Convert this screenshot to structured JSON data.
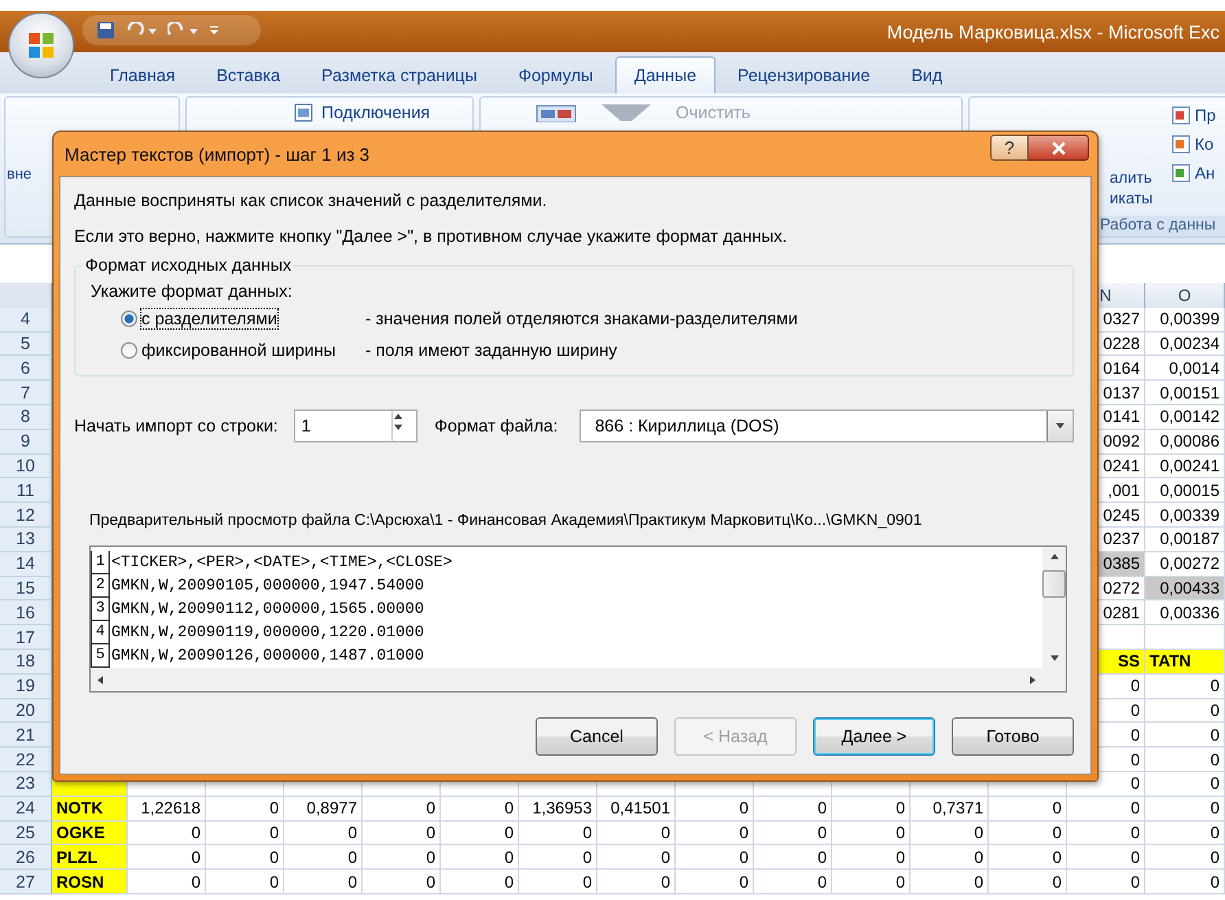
{
  "title_bar": {
    "title": "Модель Марковица.xlsx - Microsoft Exc"
  },
  "ribbon": {
    "tabs": [
      {
        "label": "Главная",
        "selected": false
      },
      {
        "label": "Вставка",
        "selected": false
      },
      {
        "label": "Разметка страницы",
        "selected": false
      },
      {
        "label": "Формулы",
        "selected": false
      },
      {
        "label": "Данные",
        "selected": true
      },
      {
        "label": "Рецензирование",
        "selected": false
      },
      {
        "label": "Вид",
        "selected": false
      }
    ],
    "left_fragment": "вне",
    "connections": "Подключения",
    "clear": {
      "label": "Очистить",
      "disabled": true
    },
    "duplicates_fragments": [
      "алить",
      "икаты"
    ],
    "side_commands": [
      "Пр",
      "Ко",
      "Ан"
    ],
    "group_label": "Работа с данны"
  },
  "sheet": {
    "column_headers": [
      "N",
      "O"
    ],
    "upper_rows": [
      {
        "row": "4",
        "kind": "values",
        "cells": [
          {
            "text": "0327",
            "shaded": false
          },
          {
            "text": "0,00399",
            "shaded": false
          }
        ]
      },
      {
        "row": "5",
        "kind": "values",
        "cells": [
          {
            "text": "0228",
            "shaded": false
          },
          {
            "text": "0,00234",
            "shaded": false
          }
        ]
      },
      {
        "row": "6",
        "kind": "values",
        "cells": [
          {
            "text": "0164",
            "shaded": false
          },
          {
            "text": "0,0014",
            "shaded": false
          }
        ]
      },
      {
        "row": "7",
        "kind": "values",
        "cells": [
          {
            "text": "0137",
            "shaded": false
          },
          {
            "text": "0,00151",
            "shaded": false
          }
        ]
      },
      {
        "row": "8",
        "kind": "values",
        "cells": [
          {
            "text": "0141",
            "shaded": false
          },
          {
            "text": "0,00142",
            "shaded": false
          }
        ]
      },
      {
        "row": "9",
        "kind": "values",
        "cells": [
          {
            "text": "0092",
            "shaded": false
          },
          {
            "text": "0,00086",
            "shaded": false
          }
        ]
      },
      {
        "row": "10",
        "kind": "values",
        "cells": [
          {
            "text": "0241",
            "shaded": false
          },
          {
            "text": "0,00241",
            "shaded": false
          }
        ]
      },
      {
        "row": "11",
        "kind": "values",
        "cells": [
          {
            "text": ",001",
            "shaded": false
          },
          {
            "text": "0,00015",
            "shaded": false
          }
        ]
      },
      {
        "row": "12",
        "kind": "values",
        "cells": [
          {
            "text": "0245",
            "shaded": false
          },
          {
            "text": "0,00339",
            "shaded": false
          }
        ]
      },
      {
        "row": "13",
        "kind": "values",
        "cells": [
          {
            "text": "0237",
            "shaded": false
          },
          {
            "text": "0,00187",
            "shaded": false
          }
        ]
      },
      {
        "row": "14",
        "kind": "values",
        "cells": [
          {
            "text": "0385",
            "shaded": true
          },
          {
            "text": "0,00272",
            "shaded": false
          }
        ]
      },
      {
        "row": "15",
        "kind": "values",
        "cells": [
          {
            "text": "0272",
            "shaded": false
          },
          {
            "text": "0,00433",
            "shaded": true
          }
        ]
      },
      {
        "row": "16",
        "kind": "values",
        "cells": [
          {
            "text": "0281",
            "shaded": false
          },
          {
            "text": "0,00336",
            "shaded": false
          }
        ]
      },
      {
        "row": "17"
      },
      {
        "row": "18",
        "kind": "tickers",
        "cells": [
          {
            "text": "SS"
          },
          {
            "text": "TATN"
          }
        ]
      },
      {
        "row": "19",
        "kind": "values",
        "cells": [
          {
            "text": "0",
            "shaded": false
          },
          {
            "text": "0",
            "shaded": false
          }
        ]
      },
      {
        "row": "20",
        "kind": "values",
        "cells": [
          {
            "text": "0",
            "shaded": false
          },
          {
            "text": "0",
            "shaded": false
          }
        ]
      },
      {
        "row": "21",
        "kind": "values",
        "cells": [
          {
            "text": "0",
            "shaded": false
          },
          {
            "text": "0",
            "shaded": false
          }
        ]
      },
      {
        "row": "22",
        "kind": "values",
        "cells": [
          {
            "text": "0",
            "shaded": false
          },
          {
            "text": "0",
            "shaded": false
          }
        ]
      },
      {
        "row": "23",
        "kind": "values",
        "cells": [
          {
            "text": "0",
            "shaded": false
          },
          {
            "text": "0",
            "shaded": false
          }
        ]
      }
    ],
    "lower_rows": [
      {
        "row": "24",
        "ticker": "NOTK",
        "values": [
          "1,22618",
          "0",
          "0,8977",
          "0",
          "0",
          "1,36953",
          "0,41501",
          "0",
          "0",
          "0",
          "0,7371",
          "0",
          "0",
          "0"
        ]
      },
      {
        "row": "25",
        "ticker": "OGKE",
        "values": [
          "0",
          "0",
          "0",
          "0",
          "0",
          "0",
          "0",
          "0",
          "0",
          "0",
          "0",
          "0",
          "0",
          "0"
        ]
      },
      {
        "row": "26",
        "ticker": "PLZL",
        "values": [
          "0",
          "0",
          "0",
          "0",
          "0",
          "0",
          "0",
          "0",
          "0",
          "0",
          "0",
          "0",
          "0",
          "0"
        ]
      },
      {
        "row": "27",
        "ticker": "ROSN",
        "values": [
          "0",
          "0",
          "0",
          "0",
          "0",
          "0",
          "0",
          "0",
          "0",
          "0",
          "0",
          "0",
          "0",
          "0"
        ]
      }
    ]
  },
  "dialog": {
    "title": "Мастер текстов (импорт) - шаг 1 из 3",
    "help": "?",
    "intro": "Данные восприняты как список значений с разделителями.",
    "hint": "Если это верно, нажмите кнопку \"Далее >\", в противном случае укажите формат данных.",
    "group_title": "Формат исходных данных",
    "prompt": "Укажите формат данных:",
    "format_options": [
      {
        "label": "с разделителями",
        "description": "- значения полей отделяются знаками-разделителями",
        "selected": true
      },
      {
        "label": "фиксированной ширины",
        "description": "- поля имеют заданную ширину",
        "selected": false
      }
    ],
    "start_row_label": "Начать импорт со строки:",
    "start_row": "1",
    "file_format_label": "Формат файла:",
    "file_format": "866 : Кириллица (DOS)",
    "preview_label": "Предварительный просмотр файла C:\\Арсюха\\1 - Финансовая Академия\\Практикум Марковитц\\Ко...\\GMKN_0901",
    "preview_lines": [
      {
        "number": "1",
        "text": "<TICKER>,<PER>,<DATE>,<TIME>,<CLOSE>"
      },
      {
        "number": "2",
        "text": "GMKN,W,20090105,000000,1947.54000"
      },
      {
        "number": "3",
        "text": "GMKN,W,20090112,000000,1565.00000"
      },
      {
        "number": "4",
        "text": "GMKN,W,20090119,000000,1220.01000"
      },
      {
        "number": "5",
        "text": "GMKN,W,20090126,000000,1487.01000"
      }
    ],
    "buttons": [
      {
        "label": "Cancel",
        "disabled": false,
        "default": false
      },
      {
        "label": "< Назад",
        "disabled": true,
        "default": false
      },
      {
        "label": "Далее >",
        "disabled": false,
        "default": true
      },
      {
        "label": "Готово",
        "disabled": false,
        "default": false
      }
    ]
  }
}
